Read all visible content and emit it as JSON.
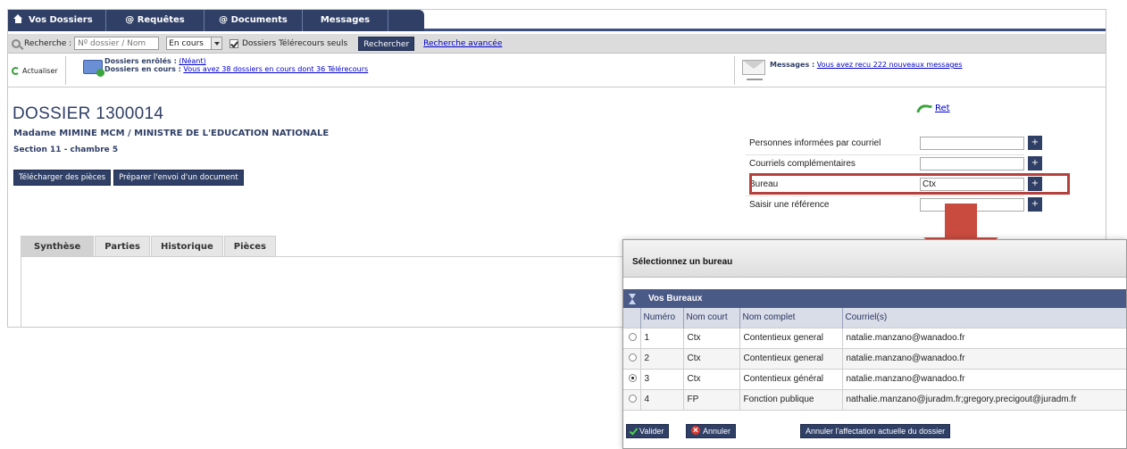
{
  "nav": {
    "tabs": [
      "Vos Dossiers",
      "@ Requêtes",
      "@ Documents",
      "Messages"
    ]
  },
  "search": {
    "label": "Recherche :",
    "placeholder": "Nº dossier / Nom",
    "status_value": "En cours",
    "checkbox_label": "Dossiers Télérecours seuls",
    "checkbox_checked": true,
    "search_button": "Rechercher",
    "advanced_link": "Recherche avancée"
  },
  "info": {
    "refresh_label": "Actualiser",
    "enrolled_label": "Dossiers enrôlés :",
    "enrolled_value": "(Néant)",
    "current_label": "Dossiers en cours :",
    "current_value": "Vous avez 38 dossiers en cours dont 36 Télérecours",
    "messages_label": "Messages :",
    "messages_value": "Vous avez recu 222 nouveaux messages"
  },
  "dossier": {
    "title": "DOSSIER 1300014",
    "parties": "Madame MIMINE MCM / MINISTRE DE L'EDUCATION NATIONALE",
    "section": "Section 11 - chambre 5",
    "download_button": "Télécharger des pièces",
    "prepare_button": "Préparer l'envoi d'un document",
    "back_link": "Ret"
  },
  "form": {
    "rows": [
      {
        "label": "Personnes informées par courriel",
        "value": ""
      },
      {
        "label": "Courriels complémentaires",
        "value": ""
      },
      {
        "label": "Bureau",
        "value": "Ctx"
      },
      {
        "label": "Saisir une référence",
        "value": ""
      }
    ],
    "plus": "+"
  },
  "tabs": [
    "Synthèse",
    "Parties",
    "Historique",
    "Pièces"
  ],
  "popup": {
    "title": "Sélectionnez un bureau",
    "section": "Vos Bureaux",
    "columns": [
      "Numéro",
      "Nom court",
      "Nom complet",
      "Courriel(s)"
    ],
    "rows": [
      {
        "num": "1",
        "short": "Ctx",
        "full": "Contentieux general",
        "email": "natalie.manzano@wanadoo.fr",
        "selected": false
      },
      {
        "num": "2",
        "short": "Ctx",
        "full": "Contentieux general",
        "email": "natalie.manzano@wanadoo.fr",
        "selected": false
      },
      {
        "num": "3",
        "short": "Ctx",
        "full": "Contentieux général",
        "email": "natalie.manzano@wanadoo.fr",
        "selected": true
      },
      {
        "num": "4",
        "short": "FP",
        "full": "Fonction publique",
        "email": "nathalie.manzano@juradm.fr;gregory.precigout@juradm.fr",
        "selected": false
      }
    ],
    "validate_button": "Valider",
    "cancel_button": "Annuler",
    "unassign_button": "Annuler l'affectation actuelle du dossier"
  },
  "colors": {
    "nav": "#2f3f66",
    "highlight": "#b5413d",
    "arrow": "#c94a3f"
  }
}
